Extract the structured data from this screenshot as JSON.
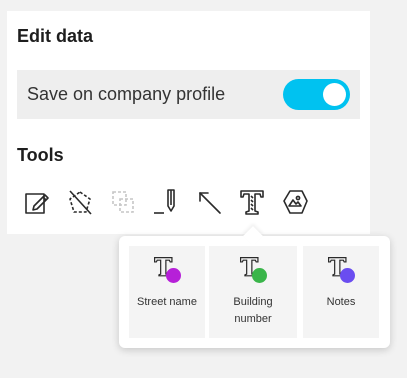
{
  "edit_data": {
    "title": "Edit data",
    "save_toggle": {
      "label": "Save on company profile",
      "on": true
    }
  },
  "tools": {
    "title": "Tools",
    "items": [
      {
        "icon": "edit-pencil-icon"
      },
      {
        "icon": "pentagon-erase-icon"
      },
      {
        "icon": "merge-shapes-icon"
      },
      {
        "icon": "pen-line-icon"
      },
      {
        "icon": "arrow-icon"
      },
      {
        "icon": "text-tool-icon"
      },
      {
        "icon": "photo-hexagon-icon"
      }
    ]
  },
  "text_options": [
    {
      "label": "Street name",
      "badge_color": "#b620d8",
      "icon": "street-name-icon"
    },
    {
      "label": "Building number",
      "badge_color": "#3ab54a",
      "icon": "building-number-icon"
    },
    {
      "label": "Notes",
      "badge_color": "#6a4df0",
      "icon": "notes-icon"
    }
  ],
  "colors": {
    "accent": "#00c2f0"
  }
}
